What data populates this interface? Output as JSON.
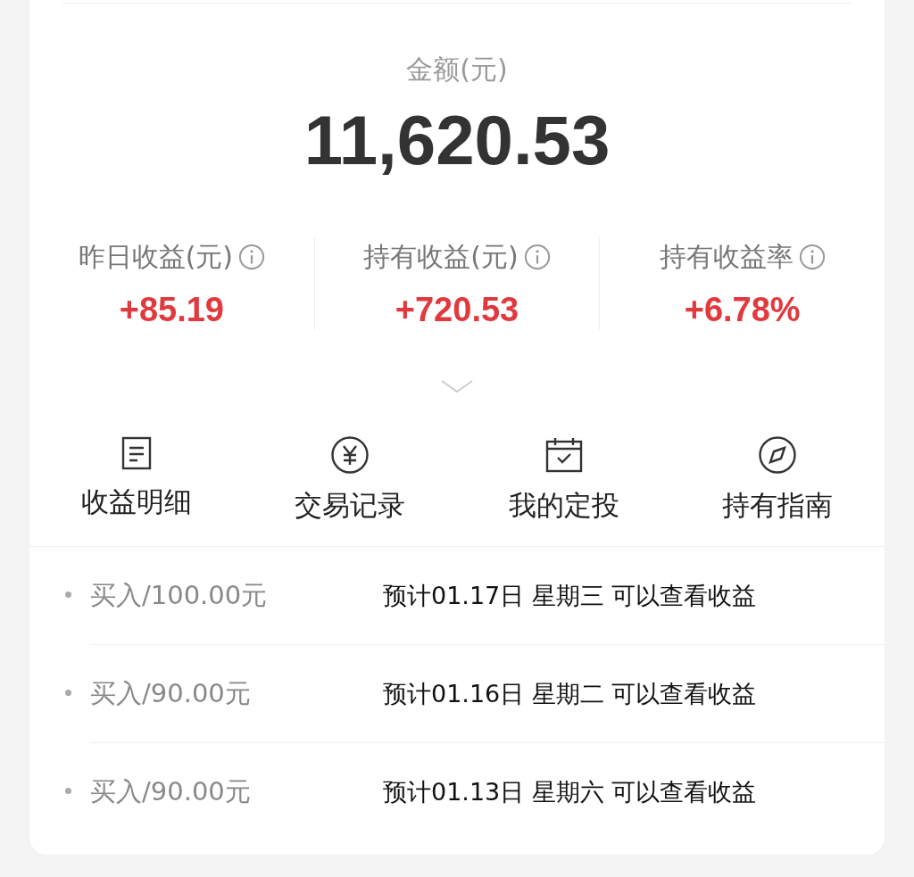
{
  "summary": {
    "label": "金额(元)",
    "amount": "11,620.53"
  },
  "stats": [
    {
      "label": "昨日收益(元)",
      "value": "+85.19"
    },
    {
      "label": "持有收益(元)",
      "value": "+720.53"
    },
    {
      "label": "持有收益率",
      "value": "+6.78%"
    }
  ],
  "shortcuts": [
    {
      "kind": "document",
      "label": "收益明细"
    },
    {
      "kind": "yuan",
      "label": "交易记录"
    },
    {
      "kind": "calendar",
      "label": "我的定投"
    },
    {
      "kind": "compass",
      "label": "持有指南"
    }
  ],
  "transactions": [
    {
      "title": "买入/100.00元",
      "note": "预计01.17日 星期三 可以查看收益"
    },
    {
      "title": "买入/90.00元",
      "note": "预计01.16日 星期二 可以查看收益"
    },
    {
      "title": "买入/90.00元",
      "note": "预计01.13日 星期六 可以查看收益"
    }
  ]
}
